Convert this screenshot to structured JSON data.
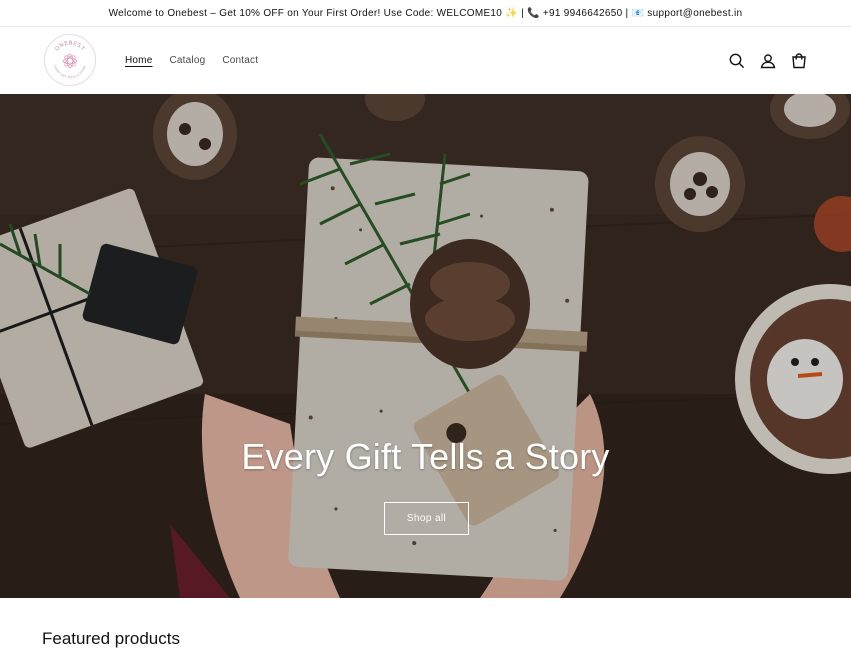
{
  "announcement": {
    "text": "Welcome to Onebest – Get 10% OFF on Your First Order! Use Code: WELCOME10 ✨ | 📞 +91 9946642650 | 📧 support@onebest.in"
  },
  "header": {
    "logo": {
      "name": "ONEBEST",
      "tagline": "EVERY GIFT TELLS A STORY"
    },
    "nav": [
      {
        "label": "Home",
        "active": true
      },
      {
        "label": "Catalog",
        "active": false
      },
      {
        "label": "Contact",
        "active": false
      }
    ],
    "icons": [
      "search-icon",
      "account-icon",
      "cart-icon"
    ]
  },
  "hero": {
    "title": "Every Gift Tells a Story",
    "button_label": "Shop all"
  },
  "featured": {
    "title": "Featured products"
  }
}
